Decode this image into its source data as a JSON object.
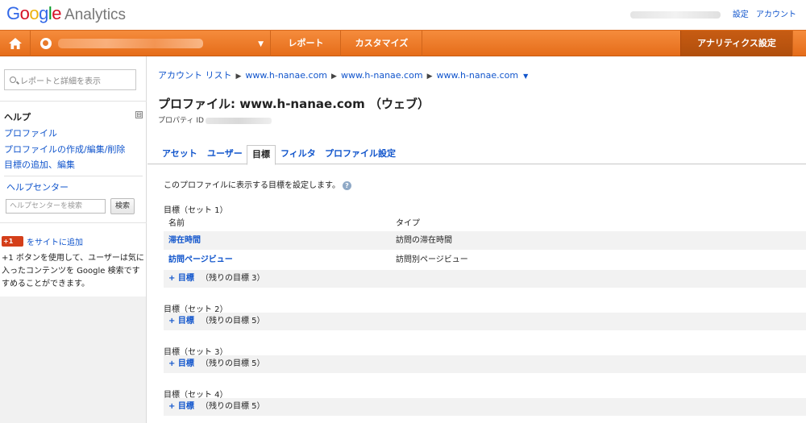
{
  "header": {
    "logo_letters": [
      "G",
      "o",
      "o",
      "g",
      "l",
      "e"
    ],
    "product": "Analytics",
    "links": [
      "設定",
      "アカウント"
    ]
  },
  "nav": {
    "tabs": [
      "レポート",
      "カスタマイズ"
    ],
    "admin": "アナリティクス設定"
  },
  "sidebar": {
    "search_placeholder": "レポートと詳細を表示",
    "help_title": "ヘルプ",
    "collapse": "⊟",
    "links": [
      "プロファイル",
      "プロファイルの作成/編集/削除",
      "目標の追加、編集"
    ],
    "help_center": "ヘルプセンター",
    "help_search_placeholder": "ヘルプセンターを検索",
    "help_search_button": "検索",
    "gplus_badge": "+1",
    "gplus_link": "をサイトに追加",
    "gplus_description": "+1 ボタンを使用して、ユーザーは気に入ったコンテンツを Google 検索ですすめることができます。"
  },
  "main": {
    "breadcrumb": [
      "アカウント リスト",
      "www.h-nanae.com",
      "www.h-nanae.com",
      "www.h-nanae.com"
    ],
    "title": "プロファイル: www.h-nanae.com （ウェブ）",
    "property_id_label": "プロパティ ID",
    "tabs": [
      "アセット",
      "ユーザー",
      "目標",
      "フィルタ",
      "プロファイル設定"
    ],
    "intro": "このプロファイルに表示する目標を設定します。",
    "help_glyph": "?",
    "columns": [
      "名前",
      "タイプ"
    ],
    "sets": [
      {
        "title": "目標（セット 1）",
        "goals": [
          {
            "name": "滞在時間",
            "type": "訪問の滞在時間"
          },
          {
            "name": "訪問ページビュー",
            "type": "訪問別ページビュー"
          }
        ],
        "add_label": "+ 目標",
        "remaining": "（残りの目標 3）"
      },
      {
        "title": "目標（セット 2）",
        "goals": [],
        "add_label": "+ 目標",
        "remaining": "（残りの目標 5）"
      },
      {
        "title": "目標（セット 3）",
        "goals": [],
        "add_label": "+ 目標",
        "remaining": "（残りの目標 5）"
      },
      {
        "title": "目標（セット 4）",
        "goals": [],
        "add_label": "+ 目標",
        "remaining": "（残りの目標 5）"
      }
    ]
  },
  "colors": {
    "nav_orange": "#ec7a28",
    "admin_dark": "#bb5410",
    "link_blue": "#1155cc"
  },
  "icons": [
    "home-icon",
    "globe-icon",
    "search-icon",
    "help-icon"
  ]
}
